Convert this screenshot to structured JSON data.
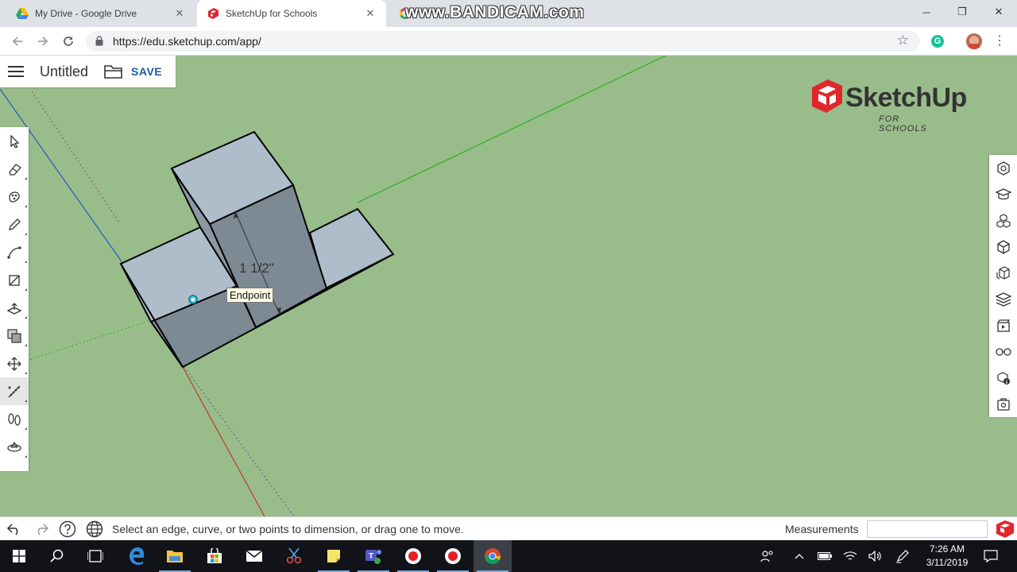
{
  "browser": {
    "tabs": [
      {
        "title": "My Drive - Google Drive",
        "active": false
      },
      {
        "title": "SketchUp for Schools",
        "active": true
      },
      {
        "title": "",
        "active": false
      }
    ],
    "watermark": "www.BANDICAM.com",
    "url": "https://edu.sketchup.com/app/"
  },
  "app": {
    "file_title": "Untitled",
    "save_label": "SAVE",
    "logo_text": "SketchUp",
    "logo_subtext": "FOR SCHOOLS",
    "left_tools": [
      "select-icon",
      "eraser-icon",
      "paint-bucket-icon",
      "pencil-icon",
      "arc-icon",
      "rectangle-icon",
      "push-pull-icon",
      "offset-icon",
      "move-icon",
      "tape-measure-icon",
      "walk-icon",
      "orbit-icon"
    ],
    "active_tool": "tape-measure-icon",
    "right_tools": [
      "entity-info-icon",
      "instructor-icon",
      "components-icon",
      "materials-icon",
      "styles-icon",
      "layers-icon",
      "scenes-icon",
      "display-icon",
      "outliner-icon",
      "export-icon"
    ],
    "tooltip": "Endpoint",
    "dimension_label": "1 1/2\"",
    "status_message": "Select an edge, curve, or two points to dimension, or drag one to move.",
    "measurements_label": "Measurements",
    "measurements_value": ""
  },
  "colors": {
    "canvas": "#99bd8a",
    "face": "#aebdc9",
    "face_shade": "#7d8a94",
    "axis_red": "#c0392b",
    "axis_green": "#2eae1f",
    "axis_blue": "#2a55c8",
    "save_blue": "#1b5aa0",
    "logo_red": "#e0272b"
  },
  "taskbar": {
    "clock_time": "7:26 AM",
    "clock_date": "3/11/2019"
  }
}
